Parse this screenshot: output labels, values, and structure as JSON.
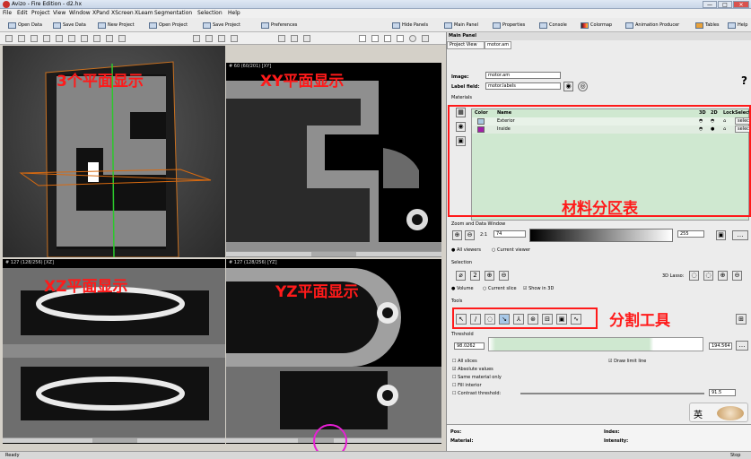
{
  "window": {
    "title": "Avizo - Fire Edition - d2.hx",
    "min": "—",
    "max": "□",
    "close": "✕"
  },
  "menu": [
    "File",
    "Edit",
    "Project",
    "View",
    "Window",
    "XPand",
    "XScreen",
    "XLeam",
    "Segmentation",
    "Selection",
    "Help"
  ],
  "toolbar": {
    "left": [
      "Open Data",
      "Save Data",
      "New Project",
      "Open Project",
      "Save Project",
      "Preferences"
    ],
    "right": [
      "Hide Panels",
      "Main Panel",
      "Properties",
      "Console",
      "Colormap",
      "Animation Producer",
      "Tables",
      "Help"
    ]
  },
  "viewers": {
    "v3d": {
      "annotation": "3个平面显示"
    },
    "xy": {
      "label": "# 60 (60/201) [XY]",
      "annotation": "XY平面显示"
    },
    "xz": {
      "label": "# 127 (128/256) [XZ]",
      "annotation": "XZ平面显示"
    },
    "yz": {
      "label": "# 127 (128/256) [YZ]",
      "annotation": "YZ平面显示"
    }
  },
  "panel": {
    "title": "Main Panel",
    "tabs": [
      "Project View",
      "motor.am"
    ],
    "image_label": "Image:",
    "image_value": "motor.am",
    "label_field_label": "Label field:",
    "label_field_value": "motor.labels",
    "help": "?",
    "materials_header": "Materials",
    "col_color": "Color",
    "col_name": "Name",
    "col_3d": "3D",
    "col_2d": "2D",
    "col_lock": "Lock",
    "col_select": "Select",
    "materials": [
      {
        "name": "Exterior",
        "color": "#a8c8e0",
        "select": "select"
      },
      {
        "name": "Inside",
        "color": "#a21ea8",
        "select": "select"
      }
    ],
    "materials_annotation": "材料分区表",
    "zoom_header": "Zoom and Data Window",
    "zoom_value": "2:1",
    "min_value": "74",
    "max_value": "255",
    "all_viewers": "All viewers",
    "current_viewer": "Current viewer",
    "selection_header": "Selection",
    "lasso_label": "3D Lasso:",
    "volume": "Volume",
    "current_slice": "Current slice",
    "show_3d": "Show in 3D",
    "tools_header": "Tools",
    "tools_annotation": "分割工具",
    "thresh_header": "Threshold",
    "thresh_min": "98.0262",
    "thresh_max": "194.564",
    "all_slices": "All slices",
    "draw_limit": "Draw limit line",
    "absolute": "Absolute values",
    "same_material": "Same material only",
    "fill_interior": "Fill interior",
    "contrast": "Contrast threshold:",
    "contrast_value": "91.5",
    "ime": "英",
    "pos_label": "Pos:",
    "index_label": "Index:",
    "material_label": "Material:",
    "intensity_label": "Intensity:"
  },
  "status": {
    "text": "Ready",
    "right": "Stop"
  },
  "colors": {
    "annotation": "#ff1a1a",
    "materials_bg": "#cfe8d0",
    "circle": "#e81fd5"
  }
}
